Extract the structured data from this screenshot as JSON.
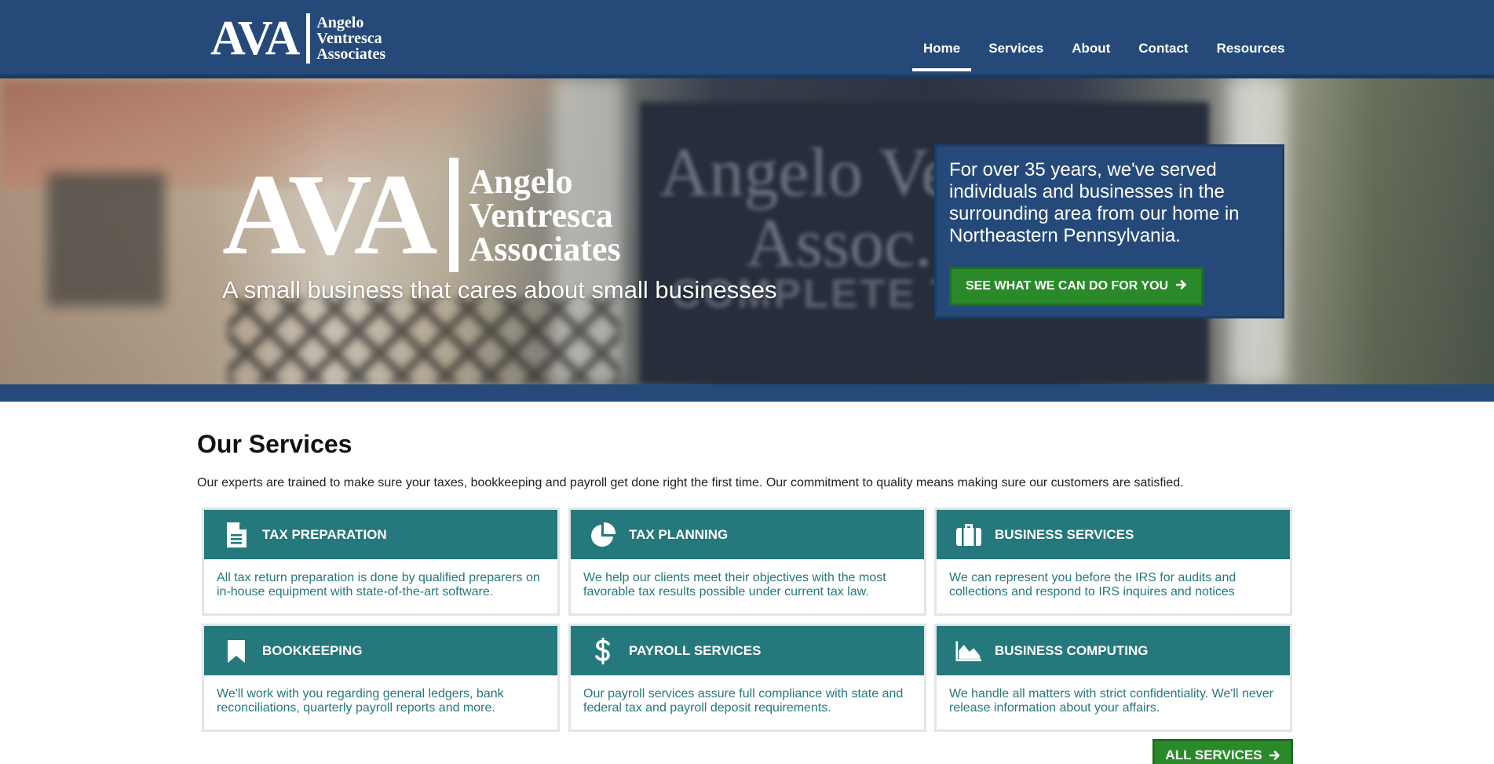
{
  "header": {
    "logo_big": "AVA",
    "logo_words": [
      "Angelo",
      "Ventresca",
      "Associates"
    ],
    "nav": [
      {
        "label": "Home",
        "active": true
      },
      {
        "label": "Services"
      },
      {
        "label": "About"
      },
      {
        "label": "Contact"
      },
      {
        "label": "Resources"
      }
    ]
  },
  "hero": {
    "logo_big": "AVA",
    "logo_words": [
      "Angelo",
      "Ventresca",
      "Associates"
    ],
    "tagline": "A small business that cares about small businesses",
    "box_text": "For over 35 years, we've served individuals and businesses in the surrounding area from our home in Northeastern Pennsylvania.",
    "cta_label": "SEE WHAT WE CAN DO FOR YOU",
    "cta_icon": "arrow-right-icon",
    "photo_sign_text": [
      "Angelo Ve",
      "Assoc.",
      "COMPLETE TAX SERVICE"
    ]
  },
  "services": {
    "title": "Our Services",
    "intro": "Our experts are trained to make sure your taxes, bookkeeping and payroll get done right the first time. Our commitment to quality means making sure our customers are satisfied.",
    "cards": [
      {
        "icon": "document-icon",
        "title": "TAX PREPARATION",
        "text": "All tax return preparation is done by qualified preparers on in-house equipment with state-of-the-art software."
      },
      {
        "icon": "pie-chart-icon",
        "title": "TAX PLANNING",
        "text": "We help our clients meet their objectives with the most favorable tax results possible under current tax law."
      },
      {
        "icon": "briefcase-icon",
        "title": "BUSINESS SERVICES",
        "text": "We can represent you before the IRS for audits and collections and respond to IRS inquires and notices"
      },
      {
        "icon": "bookmark-icon",
        "title": "BOOKKEEPING",
        "text": "We'll work with you regarding general ledgers, bank reconciliations, quarterly payroll reports and more."
      },
      {
        "icon": "dollar-icon",
        "title": "PAYROLL SERVICES",
        "text": "Our payroll services assure full compliance with state and federal tax and payroll deposit requirements."
      },
      {
        "icon": "area-chart-icon",
        "title": "BUSINESS COMPUTING",
        "text": "We handle all matters with strict confidentiality. We'll never release information about your affairs."
      }
    ],
    "all_services_label": "ALL SERVICES",
    "all_services_icon": "arrow-right-icon"
  },
  "colors": {
    "header_blue": "#254a7a",
    "teal": "#25787c",
    "green": "#2a8a2a"
  }
}
